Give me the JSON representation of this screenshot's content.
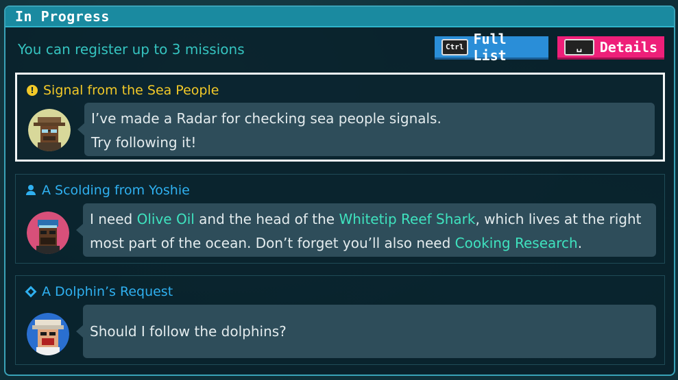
{
  "panel": {
    "title": "In Progress"
  },
  "subtitle": "You can register up to 3 missions",
  "buttons": {
    "full_list": {
      "key": "Ctrl",
      "label": "Full List"
    },
    "details": {
      "key": "␣",
      "label": "Details"
    }
  },
  "missions": [
    {
      "icon": "exclamation-icon",
      "title": "Signal from the Sea People",
      "line1": "I’ve made a Radar for checking sea people signals.",
      "line2": "Try following it!",
      "selected": true
    },
    {
      "icon": "person-icon",
      "title": "A Scolding from Yoshie",
      "p1": "I need ",
      "h1": "Olive Oil",
      "p2": " and the head of the ",
      "h2": "Whitetip Reef Shark",
      "p3": ", which lives at the right most part of the ocean. Don’t forget you’ll also need ",
      "h3": "Cooking Research",
      "p4": "."
    },
    {
      "icon": "diamond-icon",
      "title": "A Dolphin’s Request",
      "line1": "Should I follow the dolphins?"
    }
  ],
  "colors": {
    "accent": "#1a8aa0",
    "highlight": "#3fe3bf",
    "title_yellow": "#f2c928",
    "title_blue": "#2fb0f0",
    "button_blue": "#2a8ed8",
    "button_pink": "#ee1f79"
  }
}
